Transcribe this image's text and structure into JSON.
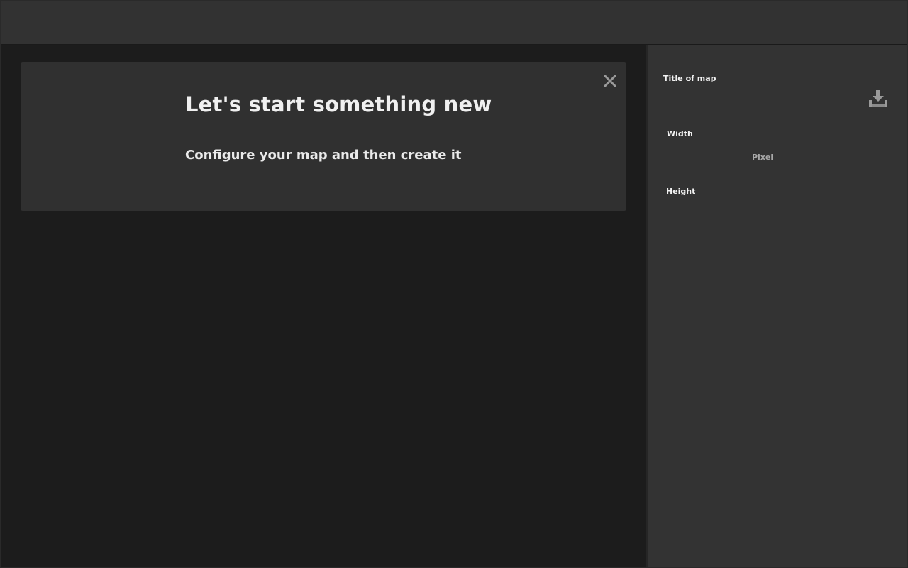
{
  "welcome": {
    "title": "Let's start something new",
    "subtitle": "Configure your map and then create it",
    "close_icon": "close-icon"
  },
  "sidebar": {
    "title_label": "Title of map",
    "width_label": "Width",
    "width_unit": "Pixel",
    "height_label": "Height",
    "download_icon": "download-icon"
  },
  "colors": {
    "topbar": "#323232",
    "main_background": "#1c1c1c",
    "card_background": "#303030",
    "sidebar_background": "#333333",
    "icon": "#9a9a9a"
  }
}
